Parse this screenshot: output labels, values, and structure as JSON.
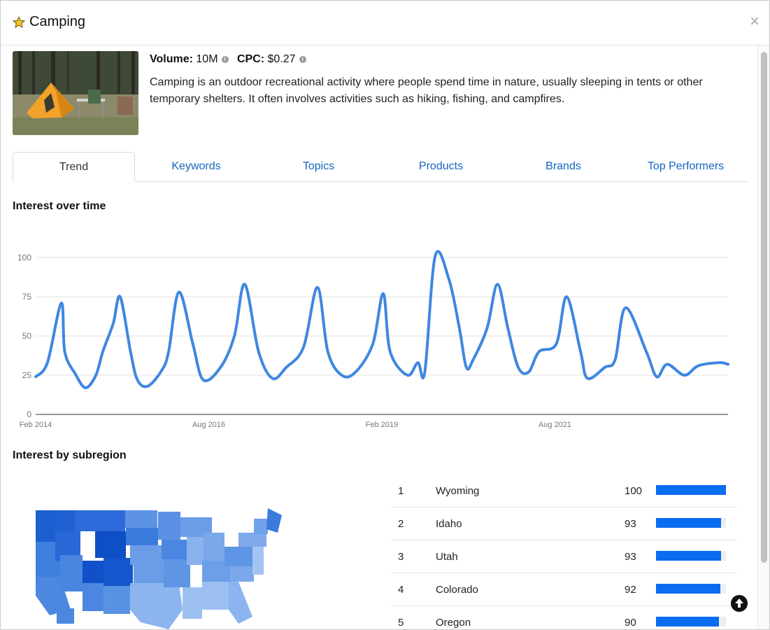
{
  "header": {
    "title": "Camping",
    "star_icon": "star-icon",
    "close_label": "×"
  },
  "meta": {
    "volume_label": "Volume:",
    "volume_value": "10M",
    "cpc_label": "CPC:",
    "cpc_value": "$0.27",
    "info_icon": "info-icon",
    "description": "Camping is an outdoor recreational activity where people spend time in nature, usually sleeping in tents or other temporary shelters. It often involves activities such as hiking, fishing, and campfires."
  },
  "tabs": [
    {
      "label": "Trend",
      "active": true
    },
    {
      "label": "Keywords"
    },
    {
      "label": "Topics"
    },
    {
      "label": "Products"
    },
    {
      "label": "Brands"
    },
    {
      "label": "Top Performers"
    }
  ],
  "sections": {
    "trend_title": "Interest over time",
    "subregion_title": "Interest by subregion"
  },
  "chart_data": {
    "type": "line",
    "title": "Interest over time",
    "x_tick_labels": [
      "Feb 2014",
      "Aug 2016",
      "Feb 2019",
      "Aug 2021"
    ],
    "x_ticks": [
      2014.08,
      2016.58,
      2019.08,
      2021.58
    ],
    "y_ticks": [
      0,
      25,
      50,
      75,
      100
    ],
    "ylim": [
      0,
      100
    ],
    "xlim": [
      2014.08,
      2024.08
    ],
    "grid": true,
    "line_color": "#3f87e0",
    "series": [
      {
        "x": [
          2014.08,
          2014.25,
          2014.45,
          2014.5,
          2014.65,
          2014.8,
          2014.95,
          2015.05,
          2015.2,
          2015.3,
          2015.45,
          2015.55,
          2015.7,
          2015.9,
          2016.0,
          2016.15,
          2016.35,
          2016.5,
          2016.75,
          2016.95,
          2017.1,
          2017.3,
          2017.5,
          2017.7,
          2017.95,
          2018.15,
          2018.3,
          2018.5,
          2018.7,
          2018.95,
          2019.1,
          2019.2,
          2019.45,
          2019.6,
          2019.7,
          2019.85,
          2020.05,
          2020.2,
          2020.3,
          2020.4,
          2020.6,
          2020.75,
          2020.9,
          2021.05,
          2021.2,
          2021.35,
          2021.6,
          2021.75,
          2021.95,
          2022.05,
          2022.3,
          2022.45,
          2022.6,
          2022.9,
          2023.05,
          2023.2,
          2023.45,
          2023.65,
          2023.95,
          2024.08
        ],
        "values": [
          24,
          33,
          71,
          40,
          26,
          17,
          25,
          40,
          58,
          75,
          40,
          22,
          18,
          28,
          40,
          78,
          45,
          22,
          30,
          50,
          83,
          40,
          23,
          30,
          43,
          81,
          40,
          25,
          27,
          45,
          77,
          40,
          25,
          33,
          27,
          101,
          86,
          55,
          30,
          35,
          55,
          83,
          55,
          30,
          27,
          40,
          45,
          75,
          40,
          23,
          30,
          35,
          68,
          40,
          24,
          32,
          25,
          31,
          33,
          32
        ]
      }
    ]
  },
  "subregions": [
    {
      "rank": "1",
      "name": "Wyoming",
      "value": "100",
      "pct": 1.0
    },
    {
      "rank": "2",
      "name": "Idaho",
      "value": "93",
      "pct": 0.93
    },
    {
      "rank": "3",
      "name": "Utah",
      "value": "93",
      "pct": 0.93
    },
    {
      "rank": "4",
      "name": "Colorado",
      "value": "92",
      "pct": 0.92
    },
    {
      "rank": "5",
      "name": "Oregon",
      "value": "90",
      "pct": 0.9
    }
  ],
  "colors": {
    "accent": "#1565c0",
    "bar": "#0a6cf0",
    "map_dark": "#1b5fd1",
    "map_light": "#8fb7f0"
  },
  "up_icon": "arrow-up-icon"
}
